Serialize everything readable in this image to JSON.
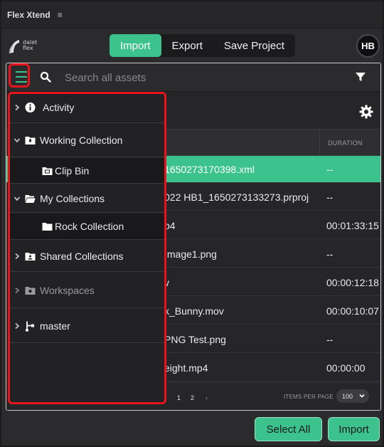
{
  "window": {
    "title": "Flex Xtend"
  },
  "brand": {
    "logo_line1": "dalet",
    "logo_line2": "flex"
  },
  "topnav": {
    "tabs": [
      {
        "label": "Import",
        "active": true
      },
      {
        "label": "Export",
        "active": false
      },
      {
        "label": "Save Project",
        "active": false
      }
    ]
  },
  "user": {
    "initials": "HB"
  },
  "search": {
    "placeholder": "Search all assets",
    "value": ""
  },
  "table": {
    "columns": {
      "duration": "DURATION"
    },
    "rows": [
      {
        "name": "1650273170398.xml",
        "duration": "--",
        "selected": true
      },
      {
        "name": "022 HB1_1650273133273.prproj",
        "duration": "--",
        "selected": false
      },
      {
        "name": "p4",
        "duration": "00:01:33:15",
        "selected": false
      },
      {
        "name": "Image1.png",
        "duration": "--",
        "selected": false
      },
      {
        "name": "v",
        "duration": "00:00:12:18",
        "selected": false
      },
      {
        "name": "k_Bunny.mov",
        "duration": "00:00:10:07",
        "selected": false
      },
      {
        "name": "PNG Test.png",
        "duration": "--",
        "selected": false
      },
      {
        "name": "eight.mp4",
        "duration": "00:00:00",
        "selected": false
      }
    ]
  },
  "pagination": {
    "pages": [
      "1",
      "2"
    ],
    "next": "›",
    "items_per_page_label": "ITEMS PER PAGE",
    "items_per_page": "100"
  },
  "sidebar": {
    "items": [
      {
        "label": "Activity",
        "icon": "info-icon",
        "expanded": false,
        "dimmed": false
      },
      {
        "label": "Working Collection",
        "icon": "collection-folder-icon",
        "expanded": true,
        "dimmed": false
      },
      {
        "label": "Clip Bin",
        "icon": "clip-bin-folder-icon",
        "child": true
      },
      {
        "label": "My Collections",
        "icon": "folder-open-icon",
        "expanded": true,
        "dimmed": false
      },
      {
        "label": "Rock Collection",
        "icon": "folder-icon",
        "child": true
      },
      {
        "label": "Shared Collections",
        "icon": "shared-folder-icon",
        "expanded": false,
        "dimmed": false
      },
      {
        "label": "Workspaces",
        "icon": "workspace-icon",
        "expanded": false,
        "dimmed": true
      },
      {
        "label": "master",
        "icon": "branch-icon",
        "expanded": false,
        "dimmed": false
      }
    ]
  },
  "footer": {
    "select_all_label": "Select All",
    "import_label": "Import"
  },
  "colors": {
    "accent": "#3cc28c",
    "highlight": "#e8141b",
    "background": "#2b2b2d"
  }
}
